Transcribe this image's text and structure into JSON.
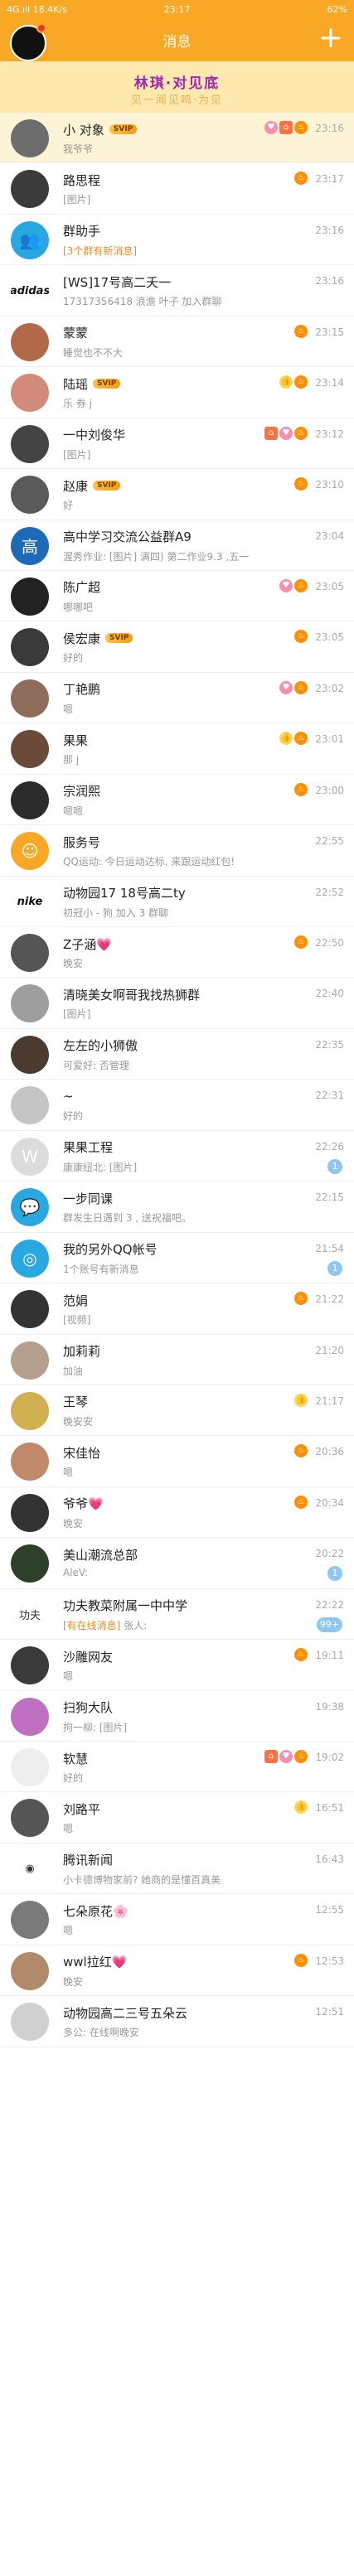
{
  "status_bar": {
    "left": "4G.ıll  18.4K/s",
    "time": "23:17",
    "battery": "62%"
  },
  "header": {
    "title": "消息",
    "plus": "+"
  },
  "banner": {
    "line1": "林琪·对见底",
    "line2": "见一闻见鸣·为见"
  },
  "colors": {
    "accent": "#f9a825",
    "banner": "#fde9ad",
    "pinned_row": "#fdf3d6"
  },
  "conversations": [
    {
      "name": "小 对象",
      "svip": true,
      "msg": "我爷爷",
      "time": "23:16",
      "badges": [
        "pink",
        "house",
        "fire"
      ],
      "pinned": true,
      "avatar_color": "#6d6d6d"
    },
    {
      "name": "路思程",
      "msg": "[图片]",
      "time": "23:17",
      "badges": [
        "fire"
      ],
      "avatar_color": "#3b3b3b"
    },
    {
      "name": "群助手",
      "msg_tag": "[3个群有新消息]",
      "msg": "",
      "time": "23:16",
      "avatar_color": "#29a7e1",
      "avatar_icon": "👥"
    },
    {
      "name": "[WS]17号高二夭一",
      "msg": "17317356418 浪澹 叶子 加入群聊",
      "time": "23:16",
      "avatar_color": "#ffffff",
      "avatar_icon": "adidas"
    },
    {
      "name": "蒙蒙",
      "msg": "睡觉也不不大",
      "time": "23:15",
      "badges": [
        "fire"
      ],
      "avatar_color": "#b06a4a"
    },
    {
      "name": "陆瑶",
      "svip": true,
      "msg": "乐 券 j",
      "time": "23:14",
      "badges": [
        "thumb",
        "fire"
      ],
      "avatar_color": "#d28a7a"
    },
    {
      "name": "一中刘俊华",
      "msg": "[图片]",
      "time": "23:12",
      "badges": [
        "house",
        "pink",
        "fire"
      ],
      "avatar_color": "#444444"
    },
    {
      "name": "赵康",
      "svip": true,
      "msg": "好",
      "time": "23:10",
      "badges": [
        "fire"
      ],
      "avatar_color": "#5a5a5a"
    },
    {
      "name": "高中学习交流公益群A9",
      "msg": "渥秀作业: [图片] 满四) 第二作业9.3 ,五一",
      "time": "23:04",
      "avatar_color": "#1e6ab4",
      "avatar_icon": "高"
    },
    {
      "name": "陈广超",
      "msg": "哪哪吧",
      "time": "23:05",
      "badges": [
        "pink",
        "fire"
      ],
      "avatar_color": "#222222"
    },
    {
      "name": "侯宏康",
      "svip": true,
      "msg": "好的",
      "time": "23:05",
      "badges": [
        "fire"
      ],
      "avatar_color": "#3a3a3a"
    },
    {
      "name": "丁艳鹏",
      "msg": "嗯",
      "time": "23:02",
      "badges": [
        "pink",
        "fire"
      ],
      "avatar_color": "#8e6e5a"
    },
    {
      "name": "果果",
      "msg": "那 j",
      "time": "23:01",
      "badges": [
        "thumb",
        "fire"
      ],
      "avatar_color": "#6b4a3a"
    },
    {
      "name": "宗润熙",
      "msg": "嗯嗯",
      "time": "23:00",
      "badges": [
        "fire"
      ],
      "avatar_color": "#2b2b2b"
    },
    {
      "name": "服务号",
      "msg": "QQ运动: 今日运动达标, 来跟运动红包!",
      "time": "22:55",
      "avatar_color": "#f9a825",
      "avatar_icon": "☺"
    },
    {
      "name": "动物园17 18号高二ty",
      "msg": "初冠小 - 狗 加入 3 群聊",
      "time": "22:52",
      "avatar_color": "#ffffff",
      "avatar_icon": "nike"
    },
    {
      "name": "Z子涵💗",
      "msg": "晚安",
      "time": "22:50",
      "badges": [
        "fire"
      ],
      "avatar_color": "#555555"
    },
    {
      "name": "清晓美女啊哥我找热狮群",
      "msg": "[图片]",
      "time": "22:40",
      "avatar_color": "#9e9e9e"
    },
    {
      "name": "左左的小狮傲",
      "msg": "可爱好: 否管理",
      "time": "22:35",
      "avatar_color": "#4a3a30"
    },
    {
      "name": "~",
      "msg": "好的",
      "time": "22:31",
      "avatar_color": "#c5c5c5"
    },
    {
      "name": "果果工程",
      "msg": "康康纽北: [图片]",
      "time": "22:26",
      "unread": "1",
      "avatar_color": "#dcdcdc",
      "avatar_icon": "W"
    },
    {
      "name": "一步同课",
      "msg": "群发生日遇到 3 , 送祝福吧。",
      "time": "22:15",
      "avatar_color": "#29a7e1",
      "avatar_icon": "💬"
    },
    {
      "name": "我的另外QQ帐号",
      "msg": "1个账号有新消息",
      "time": "21:54",
      "unread": "1",
      "avatar_color": "#29a7e1",
      "avatar_icon": "◎"
    },
    {
      "name": "范娟",
      "msg": "[视频]",
      "time": "21:22",
      "badges": [
        "fire"
      ],
      "avatar_color": "#333333"
    },
    {
      "name": "加莉莉",
      "msg": "加油",
      "time": "21:20",
      "avatar_color": "#b5a090"
    },
    {
      "name": "王琴",
      "msg": "晚安安",
      "time": "21:17",
      "badges": [
        "thumb"
      ],
      "avatar_color": "#d0b050"
    },
    {
      "name": "宋佳怡",
      "msg": "嗯",
      "time": "20:36",
      "badges": [
        "fire"
      ],
      "avatar_color": "#c08a6a"
    },
    {
      "name": "爷爷💗",
      "msg": "晚安",
      "time": "20:34",
      "badges": [
        "fire"
      ],
      "avatar_color": "#333333"
    },
    {
      "name": "美山潮流总部",
      "msg": "AleV:",
      "time": "20:22",
      "unread": "1",
      "avatar_color": "#2e3f2a"
    },
    {
      "name": "功夫教菜附属一中中学",
      "msg_tag": "[有在线消息]",
      "msg": " 张人:",
      "time": "22:22",
      "unread": "99+",
      "avatar_color": "#ffffff",
      "avatar_icon": "功夫"
    },
    {
      "name": "沙雕网友",
      "msg": "嗯",
      "time": "19:11",
      "badges": [
        "fire"
      ],
      "avatar_color": "#3a3a3a"
    },
    {
      "name": "扫狗大队",
      "msg": "拘一柳: [图片]",
      "time": "19:38",
      "avatar_color": "#c070c0"
    },
    {
      "name": "软慧",
      "msg": "好的",
      "time": "19:02",
      "badges": [
        "house",
        "pink",
        "fire"
      ],
      "avatar_color": "#eeeeee"
    },
    {
      "name": "刘路平",
      "msg": "嗯",
      "time": "16:51",
      "badges": [
        "thumb"
      ],
      "avatar_color": "#555555"
    },
    {
      "name": "腾讯新闻",
      "msg": "小卡德博物家前? 她商的是懂百真美",
      "time": "16:43",
      "avatar_color": "#ffffff",
      "avatar_icon": "◉"
    },
    {
      "name": "七朵原花🌸",
      "msg": "嗯",
      "time": "12:55",
      "avatar_color": "#7a7a7a"
    },
    {
      "name": "wwl拉红💗",
      "msg": "晚安",
      "time": "12:53",
      "badges": [
        "fire"
      ],
      "avatar_color": "#b08a6a"
    },
    {
      "name": "动物园高二三号五朵云",
      "msg": "多公: 在线啊晚安",
      "time": "12:51",
      "avatar_color": "#d0d0d0"
    }
  ]
}
